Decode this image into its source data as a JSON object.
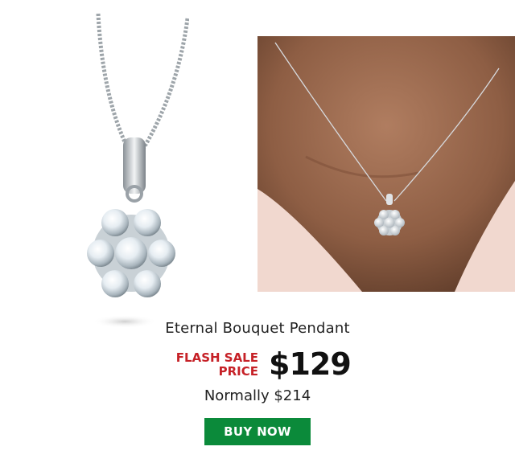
{
  "product": {
    "name": "Eternal Bouquet Pendant",
    "flash_sale_line1": "FLASH SALE",
    "flash_sale_line2": "PRICE",
    "sale_price": "$129",
    "normal_price": "Normally $214",
    "buy_label": "BUY NOW"
  },
  "colors": {
    "flash_sale": "#c62127",
    "buy_button": "#0b8a3a"
  }
}
